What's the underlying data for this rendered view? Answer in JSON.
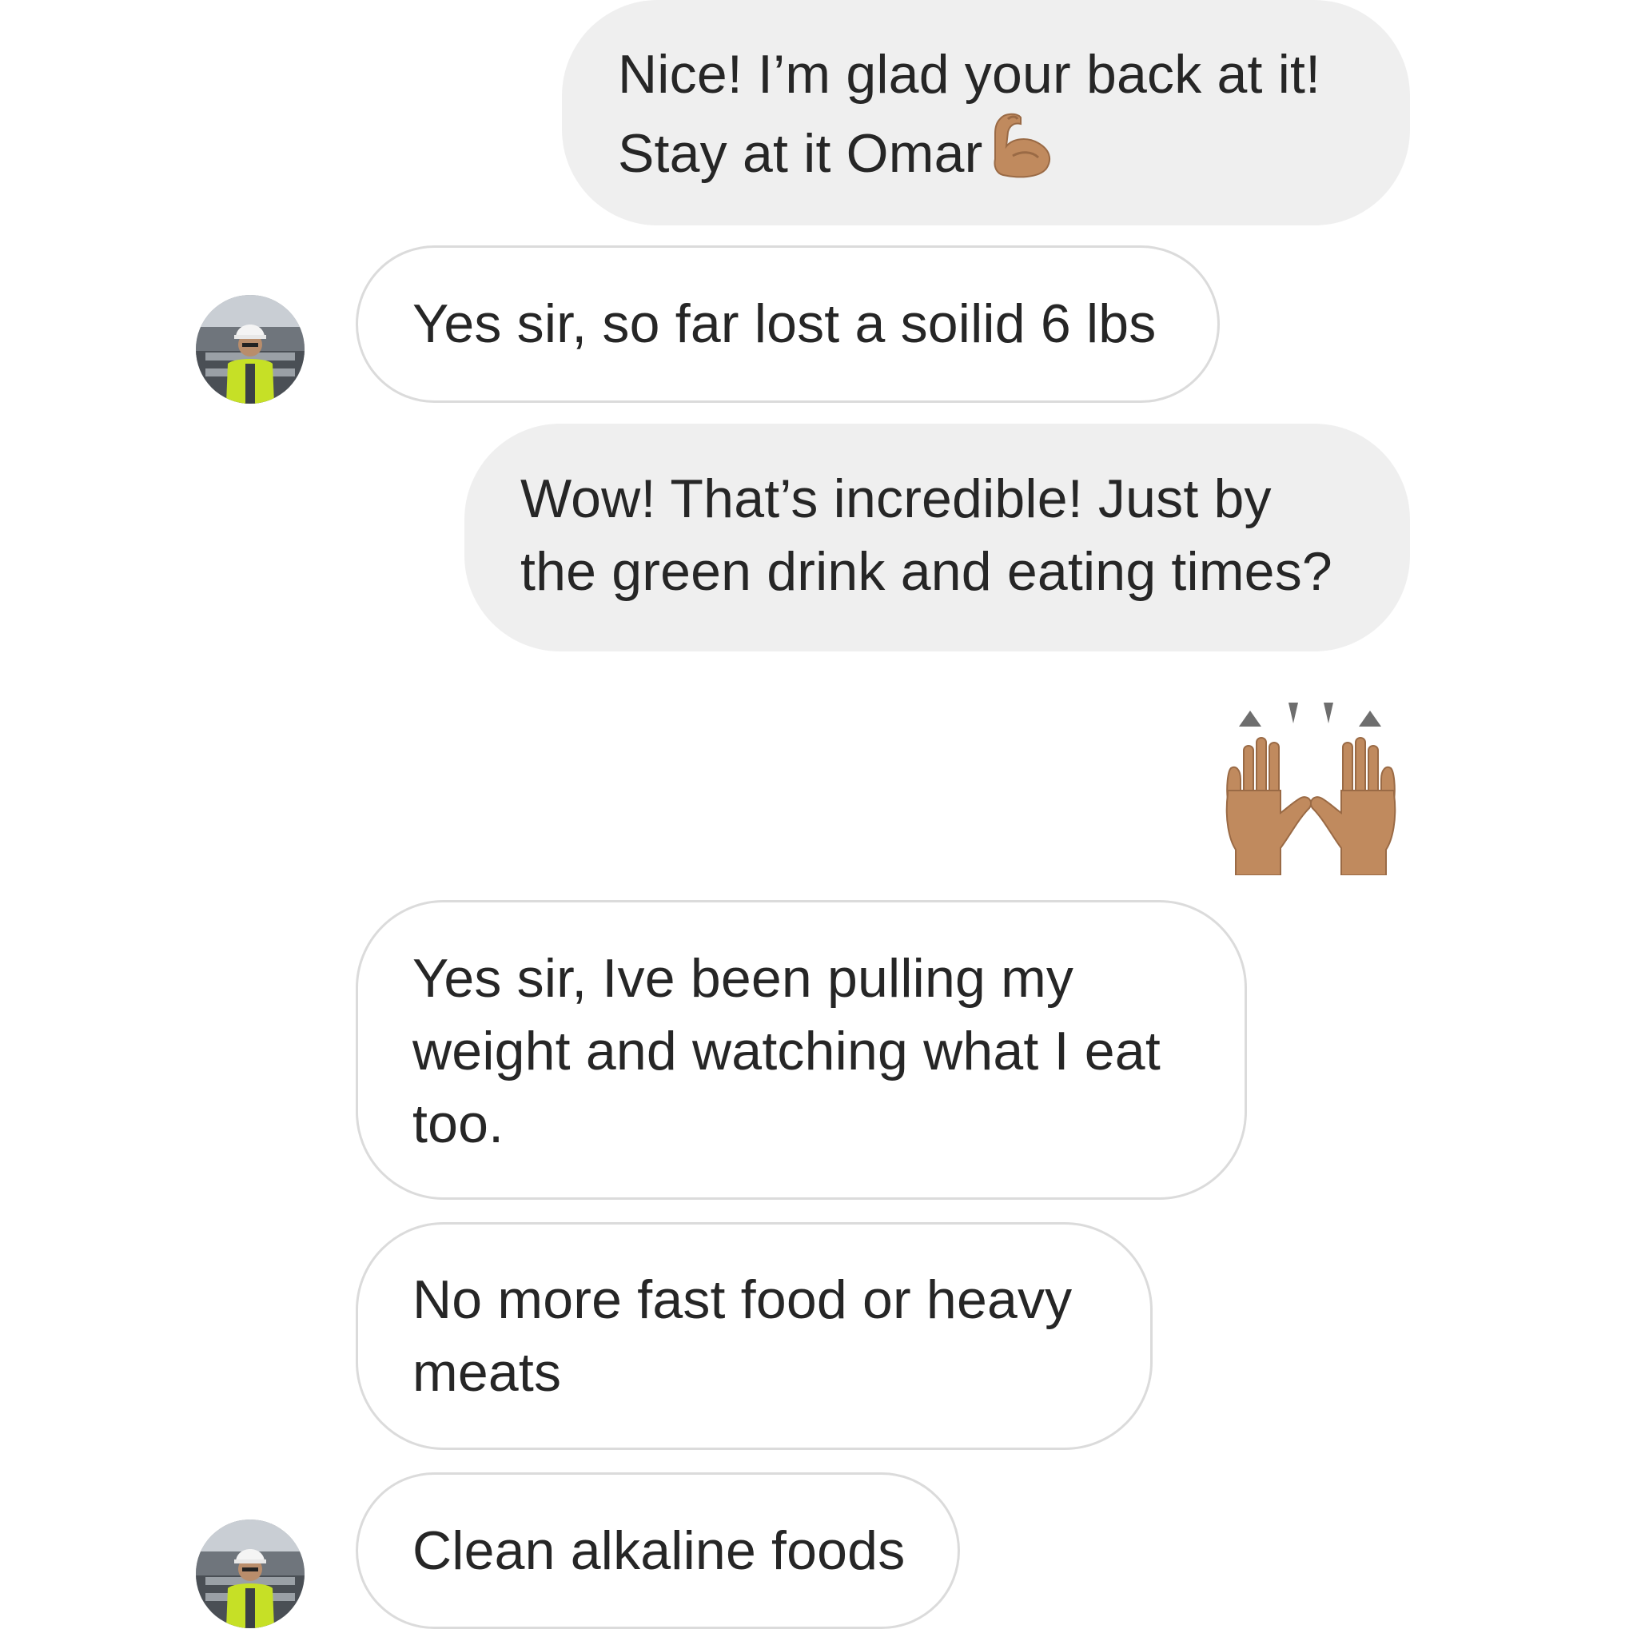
{
  "messages": [
    {
      "id": "m1",
      "direction": "outgoing",
      "lines": [
        "Nice! I’m glad your back at it!",
        "Stay at it Omar"
      ],
      "trailing_emoji": "flexed-biceps-medium-skin"
    },
    {
      "id": "m2",
      "direction": "incoming",
      "lines": [
        "Yes sir, so far lost a soilid 6 lbs"
      ],
      "show_avatar": true
    },
    {
      "id": "m3",
      "direction": "outgoing",
      "lines": [
        "Wow! That’s incredible! Just by",
        "the green drink and eating times?"
      ]
    },
    {
      "id": "m4",
      "direction": "outgoing",
      "emoji_only": "raising-hands-medium-skin"
    },
    {
      "id": "m5",
      "direction": "incoming",
      "lines": [
        "Yes sir, Ive been pulling my",
        "weight and watching what I eat",
        "too."
      ]
    },
    {
      "id": "m6",
      "direction": "incoming",
      "lines": [
        "No more fast food or heavy",
        "meats"
      ]
    },
    {
      "id": "m7",
      "direction": "incoming",
      "lines": [
        "Clean alkaline foods"
      ],
      "show_avatar": true
    }
  ],
  "colors": {
    "outgoing_bubble": "#efefef",
    "incoming_bubble": "#ffffff",
    "incoming_border": "#dbdbdb",
    "text": "#262626",
    "skin_tone": "#c08a5e"
  }
}
